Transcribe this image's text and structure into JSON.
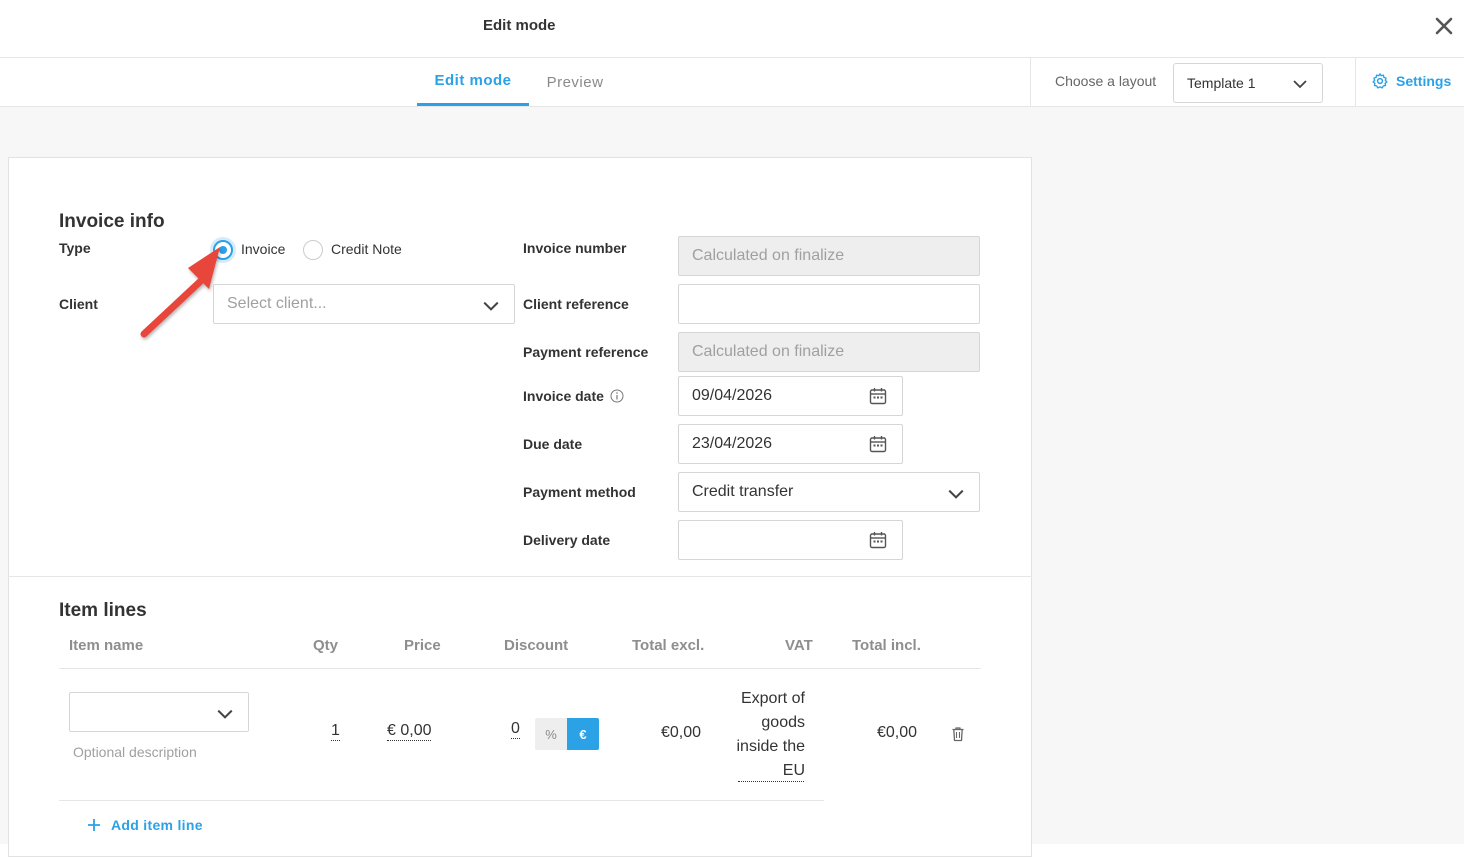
{
  "header": {
    "title": "Edit mode"
  },
  "tabs": {
    "edit": "Edit mode",
    "preview": "Preview"
  },
  "layout": {
    "label": "Choose a layout",
    "selected": "Template 1"
  },
  "settings": {
    "label": "Settings"
  },
  "invoice_info": {
    "title": "Invoice info",
    "type_label": "Type",
    "type_options": [
      "Invoice",
      "Credit Note"
    ],
    "type_selected": "Invoice",
    "client_label": "Client",
    "client_placeholder": "Select client...",
    "invoice_number_label": "Invoice number",
    "invoice_number_value": "Calculated on finalize",
    "client_reference_label": "Client reference",
    "client_reference_value": "",
    "payment_reference_label": "Payment reference",
    "payment_reference_value": "Calculated on finalize",
    "invoice_date_label": "Invoice date",
    "invoice_date_value": "09/04/2026",
    "due_date_label": "Due date",
    "due_date_value": "23/04/2026",
    "payment_method_label": "Payment method",
    "payment_method_value": "Credit transfer",
    "delivery_date_label": "Delivery date",
    "delivery_date_value": ""
  },
  "item_lines": {
    "title": "Item lines",
    "columns": [
      "Item name",
      "Qty",
      "Price",
      "Discount",
      "Total excl.",
      "VAT",
      "Total incl."
    ],
    "rows": [
      {
        "item_name": "",
        "description_placeholder": "Optional description",
        "qty": "1",
        "price": "€ 0,00",
        "discount": "0",
        "discount_pct": "%",
        "discount_eur": "€",
        "total_excl": "€0,00",
        "vat": "Export of goods inside the EU",
        "total_incl": "€0,00"
      }
    ],
    "add_label": "Add item line"
  },
  "colors": {
    "accent": "#2ba1e6",
    "annotation_arrow": "#e8443a"
  }
}
